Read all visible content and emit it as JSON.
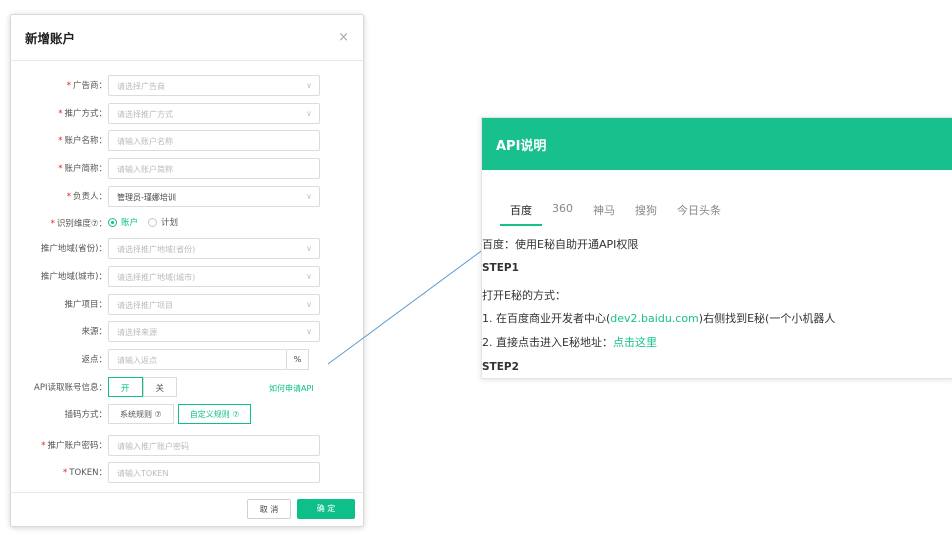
{
  "modal": {
    "title": "新增账户",
    "close_glyph": "×",
    "fields": [
      {
        "label": "广告商",
        "required": true,
        "type": "select",
        "placeholder": "请选择广告商"
      },
      {
        "label": "推广方式",
        "required": true,
        "type": "select",
        "placeholder": "请选择推广方式"
      },
      {
        "label": "账户名称",
        "required": true,
        "type": "input",
        "placeholder": "请输入账户名称"
      },
      {
        "label": "账户简称",
        "required": true,
        "type": "input",
        "placeholder": "请输入账户简称"
      },
      {
        "label": "负责人",
        "required": true,
        "type": "select",
        "value": "管理员-瑾娜培训"
      },
      {
        "label": "识别维度⑦",
        "required": true,
        "type": "radio",
        "options": [
          "账户",
          "计划"
        ],
        "selected": "账户"
      },
      {
        "label": "推广地域(省份)",
        "required": false,
        "type": "select",
        "placeholder": "请选择推广地域(省份)"
      },
      {
        "label": "推广地域(城市)",
        "required": false,
        "type": "select",
        "placeholder": "请选择推广地域(城市)"
      },
      {
        "label": "推广项目",
        "required": false,
        "type": "select",
        "placeholder": "请选择推广项目"
      },
      {
        "label": "来源",
        "required": false,
        "type": "select",
        "placeholder": "请选择来源"
      },
      {
        "label": "返点",
        "required": false,
        "type": "input",
        "placeholder": "请输入返点",
        "unit": "%"
      },
      {
        "label": "API读取账号信息",
        "required": false,
        "type": "toggle",
        "options": [
          "开",
          "关"
        ],
        "selected": "开",
        "link": "如何申请API"
      },
      {
        "label": "插码方式",
        "required": false,
        "type": "buttons",
        "options": [
          "系统规则 ⑦",
          "自定义规则 ⑦"
        ],
        "selected": "自定义规则 ⑦"
      },
      {
        "label": "推广账户密码",
        "required": true,
        "type": "input",
        "placeholder": "请输入推广账户密码"
      },
      {
        "label": "TOKEN",
        "required": true,
        "type": "input",
        "placeholder": "请输入TOKEN"
      }
    ],
    "cancel_label": "取 消",
    "ok_label": "确 定"
  },
  "api_panel": {
    "title": "API说明",
    "tabs": [
      "百度",
      "360",
      "神马",
      "搜狗",
      "今日头条"
    ],
    "active_tab": "百度",
    "lines": {
      "intro": "百度：使用E秘自助开通API权限",
      "step1": "STEP1",
      "open_way": "打开E秘的方式：",
      "item1_prefix": "1. 在百度商业开发者中心(",
      "item1_link": "dev2.baidu.com",
      "item1_suffix": ")右侧找到E秘(一个小机器人",
      "item2_prefix": "2. 直接点击进入E秘地址：",
      "item2_link": "点击这里",
      "step2": "STEP2"
    }
  },
  "colors": {
    "accent": "#17c08d",
    "required": "#e02020"
  }
}
